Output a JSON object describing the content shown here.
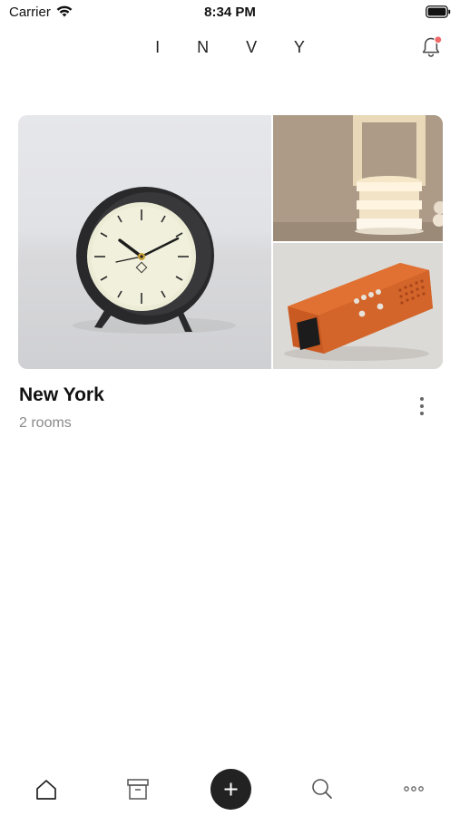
{
  "status_bar": {
    "carrier": "Carrier",
    "time": "8:34 PM"
  },
  "header": {
    "logo": "I N V Y",
    "notification_badge_color": "#f06a6a"
  },
  "location_card": {
    "title": "New York",
    "subtitle": "2 rooms"
  },
  "tabbar": {
    "items": [
      {
        "icon": "home-icon"
      },
      {
        "icon": "archive-icon"
      },
      {
        "icon": "plus-icon"
      },
      {
        "icon": "search-icon"
      },
      {
        "icon": "more-horizontal-icon"
      }
    ]
  },
  "colors": {
    "text_primary": "#111111",
    "text_secondary": "#8a8a8a",
    "fab_background": "#222222"
  }
}
